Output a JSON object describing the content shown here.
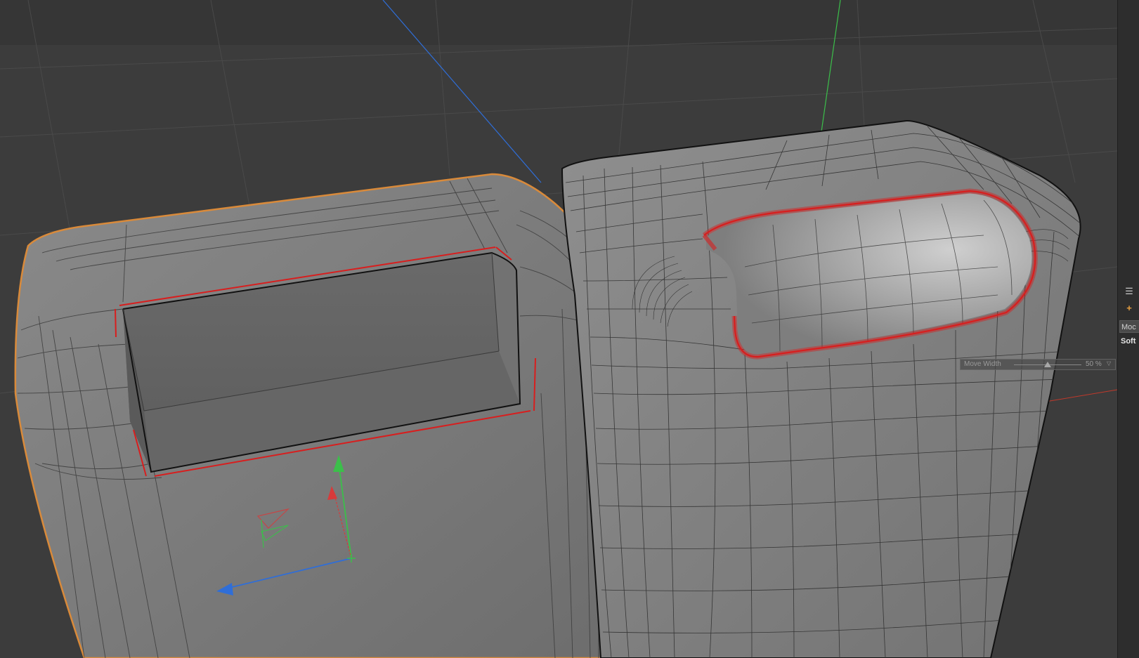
{
  "viewport": {
    "background": "#3c3c3c",
    "axis_colors": {
      "x": "#c0392b",
      "y": "#3bbf4a",
      "z": "#2f6ed8"
    },
    "selection_color": "#d81e1e",
    "object_outline_color": "#d98a3a"
  },
  "hud": {
    "move_width_label": "Move Width",
    "move_width_value": "50 %",
    "move_width_fraction": 0.5
  },
  "side_panel": {
    "menu_icon": "hamburger-icon",
    "add_icon": "plus-icon",
    "mode_label": "Moc",
    "soft_label": "Soft"
  }
}
